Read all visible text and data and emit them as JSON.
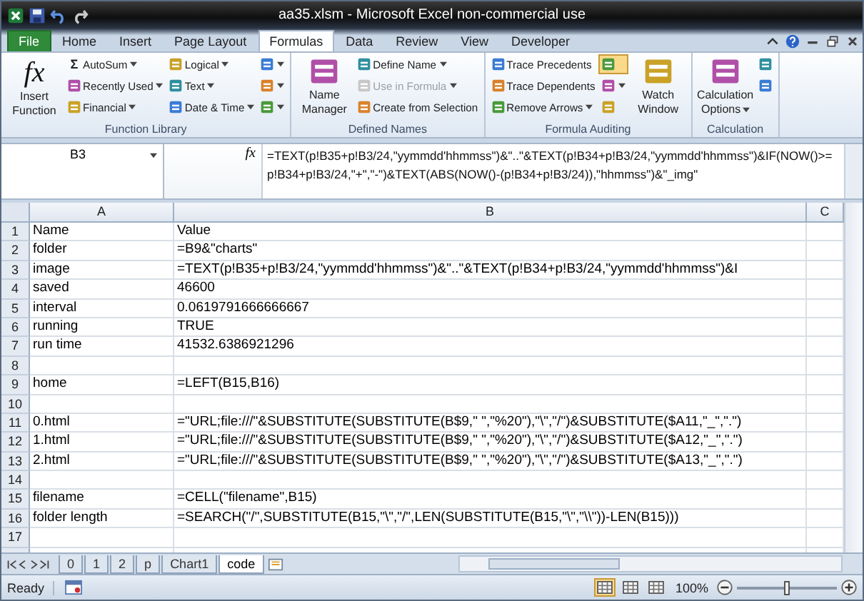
{
  "window": {
    "title": "aa35.xlsm  -  Microsoft Excel non-commercial use"
  },
  "tabs": [
    {
      "label": "File",
      "kind": "file",
      "selected": false
    },
    {
      "label": "Home",
      "kind": "tab",
      "selected": false
    },
    {
      "label": "Insert",
      "kind": "tab",
      "selected": false
    },
    {
      "label": "Page Layout",
      "kind": "tab",
      "selected": false
    },
    {
      "label": "Formulas",
      "kind": "tab",
      "selected": true
    },
    {
      "label": "Data",
      "kind": "tab",
      "selected": false
    },
    {
      "label": "Review",
      "kind": "tab",
      "selected": false
    },
    {
      "label": "View",
      "kind": "tab",
      "selected": false
    },
    {
      "label": "Developer",
      "kind": "tab",
      "selected": false
    }
  ],
  "ribbon": [
    {
      "label": "Function Library",
      "items": [
        {
          "kind": "large",
          "label": "Insert Function",
          "glyph": "fx"
        },
        {
          "kind": "stack",
          "buttons": [
            {
              "label": "AutoSum",
              "glyph": "Σ",
              "dropdown": true
            },
            {
              "label": "Recently Used",
              "dropdown": true
            },
            {
              "label": "Financial",
              "dropdown": true
            }
          ]
        },
        {
          "kind": "stack",
          "buttons": [
            {
              "label": "Logical",
              "dropdown": true
            },
            {
              "label": "Text",
              "dropdown": true
            },
            {
              "label": "Date & Time",
              "dropdown": true
            }
          ]
        },
        {
          "kind": "stack",
          "buttons": [
            {
              "dropdown": true
            },
            {
              "dropdown": true
            },
            {
              "dropdown": true
            }
          ]
        }
      ]
    },
    {
      "label": "Defined Names",
      "items": [
        {
          "kind": "large",
          "label": "Name Manager"
        },
        {
          "kind": "stack",
          "buttons": [
            {
              "label": "Define Name",
              "dropdown": true,
              "disabled": false
            },
            {
              "label": "Use in Formula",
              "dropdown": true,
              "disabled": true
            },
            {
              "label": "Create from Selection",
              "dropdown": false,
              "disabled": false
            }
          ]
        }
      ]
    },
    {
      "label": "Formula Auditing",
      "items": [
        {
          "kind": "stack",
          "buttons": [
            {
              "label": "Trace Precedents",
              "dropdown": false
            },
            {
              "label": "Trace Dependents",
              "dropdown": false
            },
            {
              "label": "Remove Arrows",
              "dropdown": true
            }
          ]
        },
        {
          "kind": "stack",
          "buttons": [
            {
              "dropdown": false,
              "selected": true
            },
            {
              "dropdown": true,
              "selected": false
            },
            {
              "dropdown": false,
              "selected": false
            }
          ]
        },
        {
          "kind": "large",
          "label": "Watch Window"
        }
      ]
    },
    {
      "label": "Calculation",
      "items": [
        {
          "kind": "large",
          "label": "Calculation Options",
          "dropdown": true
        },
        {
          "kind": "stack",
          "buttons": [
            {
              "dropdown": false
            },
            {
              "dropdown": false
            }
          ]
        }
      ]
    }
  ],
  "formula_bar": {
    "name_box": "B3",
    "fx": "fx",
    "formula": "=TEXT(p!B35+p!B3/24,\"yymmdd'hhmmss\")&\"..\"&TEXT(p!B34+p!B3/24,\"yymmdd'hhmmss\")&IF(NOW()>=p!B34+p!B3/24,\"+\",\"-\")&TEXT(ABS(NOW()-(p!B34+p!B3/24)),\"hhmmss\")&\"_img\""
  },
  "columns": [
    "A",
    "B",
    "C"
  ],
  "rows": [
    {
      "row": "1",
      "A": "Name",
      "B": "Value"
    },
    {
      "row": "2",
      "A": "folder",
      "B": "=B9&\"charts\""
    },
    {
      "row": "3",
      "A": "image",
      "B": "=TEXT(p!B35+p!B3/24,\"yymmdd'hhmmss\")&\"..\"&TEXT(p!B34+p!B3/24,\"yymmdd'hhmmss\")&I"
    },
    {
      "row": "4",
      "A": "saved",
      "B": "46600"
    },
    {
      "row": "5",
      "A": "interval",
      "B": "0.0619791666666667"
    },
    {
      "row": "6",
      "A": "running",
      "B": "TRUE"
    },
    {
      "row": "7",
      "A": "run time",
      "B": "41532.6386921296"
    },
    {
      "row": "8"
    },
    {
      "row": "9",
      "A": "home",
      "B": "=LEFT(B15,B16)"
    },
    {
      "row": "10"
    },
    {
      "row": "11",
      "A": "0.html",
      "B": "=\"URL;file:///\"&SUBSTITUTE(SUBSTITUTE(B$9,\" \",\"%20\"),\"\\\",\"/\")&SUBSTITUTE($A11,\"_\",\".\")"
    },
    {
      "row": "12",
      "A": "1.html",
      "B": "=\"URL;file:///\"&SUBSTITUTE(SUBSTITUTE(B$9,\" \",\"%20\"),\"\\\",\"/\")&SUBSTITUTE($A12,\"_\",\".\")"
    },
    {
      "row": "13",
      "A": "2.html",
      "B": "=\"URL;file:///\"&SUBSTITUTE(SUBSTITUTE(B$9,\" \",\"%20\"),\"\\\",\"/\")&SUBSTITUTE($A13,\"_\",\".\")"
    },
    {
      "row": "14"
    },
    {
      "row": "15",
      "A": "filename",
      "B": "=CELL(\"filename\",B15)"
    },
    {
      "row": "16",
      "A": "folder length",
      "B": "=SEARCH(\"/\",SUBSTITUTE(B15,\"\\\",\"/\",LEN(SUBSTITUTE(B15,\"\\\",\"\\\\\"))-LEN(B15)))"
    },
    {
      "row": "17"
    }
  ],
  "sheet_tabs": [
    {
      "label": "0",
      "selected": false
    },
    {
      "label": "1",
      "selected": false
    },
    {
      "label": "2",
      "selected": false
    },
    {
      "label": "p",
      "selected": false
    },
    {
      "label": "Chart1",
      "selected": false
    },
    {
      "label": "code",
      "selected": true
    }
  ],
  "status_bar": {
    "status": "Ready",
    "views": [
      {
        "selected": true
      },
      {
        "selected": false
      },
      {
        "selected": false
      }
    ],
    "zoom": "100%",
    "zoom_slider": {
      "level": 0.5
    }
  }
}
